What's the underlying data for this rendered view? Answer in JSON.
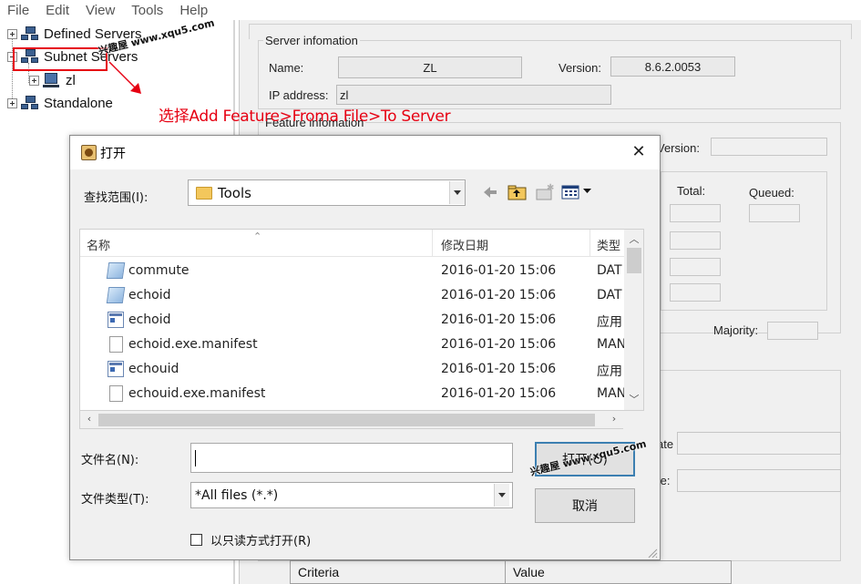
{
  "menu": [
    "File",
    "Edit",
    "View",
    "Tools",
    "Help"
  ],
  "tree": {
    "items": [
      {
        "label": "Defined Servers"
      },
      {
        "label": "Subnet Servers"
      },
      {
        "label": "zl"
      },
      {
        "label": "Standalone"
      }
    ]
  },
  "annotation": "选择Add Feature>Froma File>To Server",
  "watermark": "兴趣屋 www.xqu5.com",
  "server_info": {
    "group_title": "Server infomation",
    "name_label": "Name:",
    "name_value": "ZL",
    "version_label": "Version:",
    "version_value": "8.6.2.0053",
    "ip_label": "IP address:",
    "ip_value": "zl"
  },
  "feature_info": {
    "group_title": "Feature infomation",
    "version_label": "Version:",
    "total_label": "Total:",
    "queued_label": "Queued:",
    "majority_label": "Majority:",
    "date_label_fragment": "ate",
    "date_label_fragment2": "te:"
  },
  "criteria_table": {
    "columns": [
      "Criteria",
      "Value"
    ]
  },
  "dialog": {
    "title": "打开",
    "close_glyph": "✕",
    "lookin_label": "查找范围(I):",
    "lookin_value": "Tools",
    "columns": {
      "name": "名称",
      "date": "修改日期",
      "type": "类型"
    },
    "files": [
      {
        "name": "commute",
        "date": "2016-01-20 15:06",
        "type": "DAT",
        "icon": "dat-file-icon"
      },
      {
        "name": "echoid",
        "date": "2016-01-20 15:06",
        "type": "DAT",
        "icon": "dat-file-icon"
      },
      {
        "name": "echoid",
        "date": "2016-01-20 15:06",
        "type": "应用",
        "icon": "exe-file-icon"
      },
      {
        "name": "echoid.exe.manifest",
        "date": "2016-01-20 15:06",
        "type": "MAN",
        "icon": "document-icon"
      },
      {
        "name": "echouid",
        "date": "2016-01-20 15:06",
        "type": "应用",
        "icon": "exe-file-icon"
      },
      {
        "name": "echouid.exe.manifest",
        "date": "2016-01-20 15:06",
        "type": "MAN",
        "icon": "document-icon"
      }
    ],
    "filename_label": "文件名(N):",
    "filename_value": "",
    "filetype_label": "文件类型(T):",
    "filetype_value": "*All files (*.*)",
    "open_button": "打开(O)",
    "cancel_button": "取消",
    "readonly_label": "以只读方式打开(R)"
  },
  "colors": {
    "accent_red": "#e60012",
    "default_button_border": "#3c7fb1"
  }
}
